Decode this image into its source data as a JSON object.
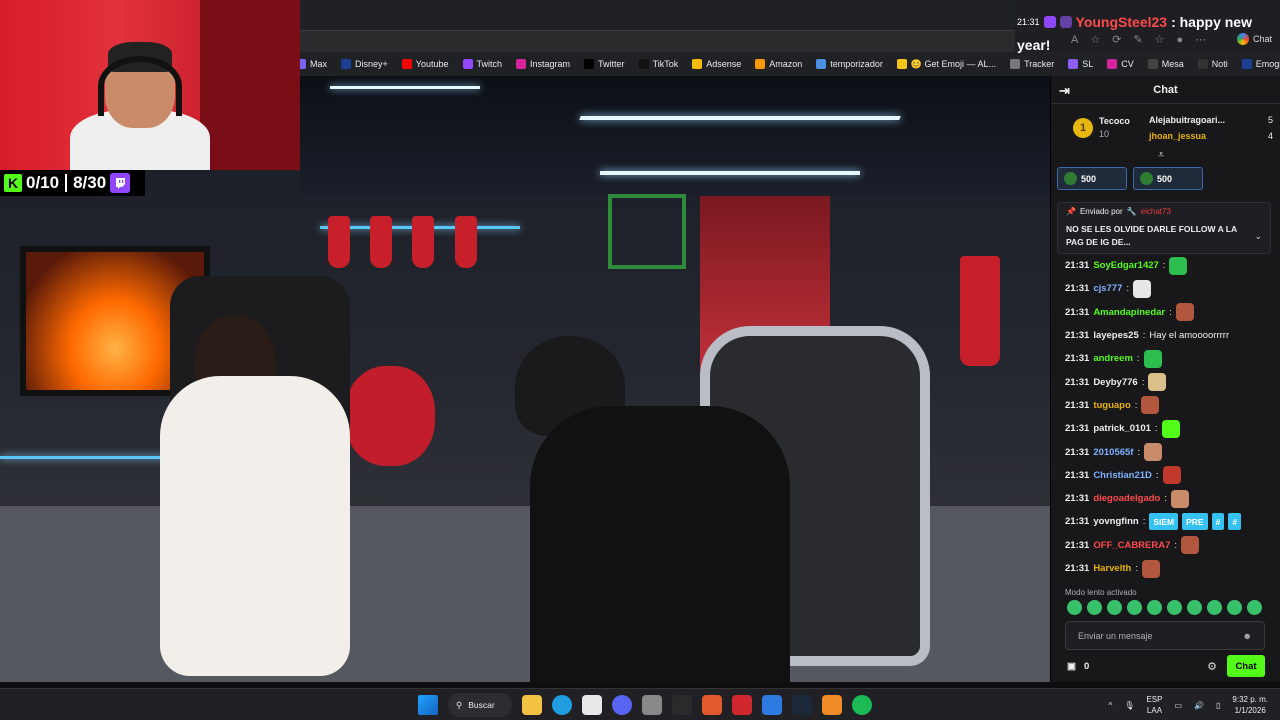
{
  "webcam_overlay": {
    "counter_a": "0/10",
    "counter_b": "8/30",
    "kick_glyph": "K"
  },
  "browser": {
    "bookmarks": [
      {
        "label": "Max",
        "icon": "max-icon",
        "color": "#7b61ff"
      },
      {
        "label": "Disney+",
        "icon": "disney-icon",
        "color": "#1c3f94"
      },
      {
        "label": "Youtube",
        "icon": "youtube-icon",
        "color": "#ff0000"
      },
      {
        "label": "Twitch",
        "icon": "twitch-icon",
        "color": "#9146ff"
      },
      {
        "label": "Instagram",
        "icon": "instagram-icon",
        "color": "#d6249f"
      },
      {
        "label": "Twitter",
        "icon": "x-icon",
        "color": "#000000"
      },
      {
        "label": "TikTok",
        "icon": "tiktok-icon",
        "color": "#111111"
      },
      {
        "label": "Adsense",
        "icon": "adsense-icon",
        "color": "#fbbc05"
      },
      {
        "label": "Amazon",
        "icon": "amazon-icon",
        "color": "#ff9900"
      },
      {
        "label": "temporizador",
        "icon": "timer-icon",
        "color": "#4a90e2"
      },
      {
        "label": "😊 Get Emoji — AL...",
        "icon": "emoji-icon",
        "color": "#f5c518"
      },
      {
        "label": "Tracker",
        "icon": "tracker-icon",
        "color": "#777777"
      },
      {
        "label": "SL",
        "icon": "sl-icon",
        "color": "#8b5cf6"
      },
      {
        "label": "CV",
        "icon": "cv-icon",
        "color": "#d6249f"
      },
      {
        "label": "Mesa",
        "icon": "mesa-icon",
        "color": "#444444"
      },
      {
        "label": "Noti",
        "icon": "noti-icon",
        "color": "#333333"
      },
      {
        "label": "Emogis",
        "icon": "emogis-icon",
        "color": "#1c3f94"
      }
    ],
    "bookmarks_more": "›"
  },
  "toast": {
    "time": "21:31",
    "username": "YoungSteel23",
    "message": ": happy new",
    "message_cont": "year!",
    "chat_label": "Chat"
  },
  "chat": {
    "title": "Chat",
    "leaderboard": {
      "rank": "1",
      "top_user": "Tecoco",
      "top_value": "10",
      "others": [
        {
          "user": "Alejabuitragoari...",
          "value": "5",
          "color": "#efeff1"
        },
        {
          "user": "jhoan_jessua",
          "value": "4",
          "color": "#e6b100"
        }
      ]
    },
    "gift_pills": [
      {
        "value": "500"
      },
      {
        "value": "500"
      }
    ],
    "pinned": {
      "by_label": "Enviado por",
      "by_user": "elchat73",
      "text": "NO SE LES OLVIDE DARLE FOLLOW A LA PAG DE IG DE..."
    },
    "messages": [
      {
        "time": "21:31",
        "user": "SoyEdgar1427",
        "color": "#53fc18",
        "text": "",
        "emote_color": "#2ebd4f"
      },
      {
        "time": "21:31",
        "user": "cjs777",
        "color": "#7fb2ff",
        "text": "",
        "emote_color": "#e6e6e6"
      },
      {
        "time": "21:31",
        "user": "Amandapinedar",
        "color": "#53fc18",
        "text": "",
        "emote_color": "#b0573d"
      },
      {
        "time": "21:31",
        "user": "layepes25",
        "color": "#efeff1",
        "text": "Hay el amoooorrrrr",
        "emote_color": ""
      },
      {
        "time": "21:31",
        "user": "andreem",
        "color": "#53fc18",
        "text": "",
        "emote_color": "#2ebd4f"
      },
      {
        "time": "21:31",
        "user": "Deyby776",
        "color": "#efeff1",
        "text": "",
        "emote_color": "#d9c08a"
      },
      {
        "time": "21:31",
        "user": "tuguapo",
        "color": "#e6b100",
        "text": "",
        "emote_color": "#b0573d"
      },
      {
        "time": "21:31",
        "user": "patrick_0101",
        "color": "#efeff1",
        "text": "",
        "emote_color": "#53fc18"
      },
      {
        "time": "21:31",
        "user": "2010565f",
        "color": "#7fb2ff",
        "text": "",
        "emote_color": "#c98b6a"
      },
      {
        "time": "21:31",
        "user": "Christian21D",
        "color": "#7fb2ff",
        "text": "",
        "emote_color": "#c0392b"
      },
      {
        "time": "21:31",
        "user": "diegoadelgado",
        "color": "#ff4a4a",
        "text": "",
        "emote_color": "#c98b6a"
      },
      {
        "time": "21:31",
        "user": "yovngfinn",
        "color": "#efeff1",
        "text": "",
        "emote_color": ""
      },
      {
        "time": "21:31",
        "user": "OFF_CABRERA7",
        "color": "#ff4a4a",
        "text": "",
        "emote_color": "#b0573d"
      },
      {
        "time": "21:31",
        "user": "Harvelth",
        "color": "#e6b100",
        "text": "",
        "emote_color": "#b0573d"
      }
    ],
    "blue_emotes": [
      "SIEM",
      "PRE",
      "#",
      "#"
    ],
    "slow_mode": "Modo lento activado",
    "input_placeholder": "Enviar un mensaje",
    "points": "0",
    "send_label": "Chat"
  },
  "taskbar": {
    "search_label": "Buscar",
    "lang_top": "ESP",
    "lang_bottom": "LAA",
    "time": "9:32 p. m.",
    "date": "1/1/2026",
    "apps": [
      {
        "icon": "file-explorer-icon",
        "color": "#f4c242"
      },
      {
        "icon": "edge-icon",
        "color": "#1f9de0"
      },
      {
        "icon": "app-icon",
        "color": "#e8e8e8"
      },
      {
        "icon": "discord-icon",
        "color": "#5865f2"
      },
      {
        "icon": "app-icon-2",
        "color": "#888888"
      },
      {
        "icon": "epic-icon",
        "color": "#2a2a2a"
      },
      {
        "icon": "app-icon-3",
        "color": "#e05a2b"
      },
      {
        "icon": "app-icon-4",
        "color": "#d0272f"
      },
      {
        "icon": "app-icon-5",
        "color": "#2d7be0"
      },
      {
        "icon": "steam-icon",
        "color": "#1b2838"
      },
      {
        "icon": "app-icon-6",
        "color": "#f08a24"
      },
      {
        "icon": "spotify-icon",
        "color": "#1db954"
      }
    ]
  }
}
